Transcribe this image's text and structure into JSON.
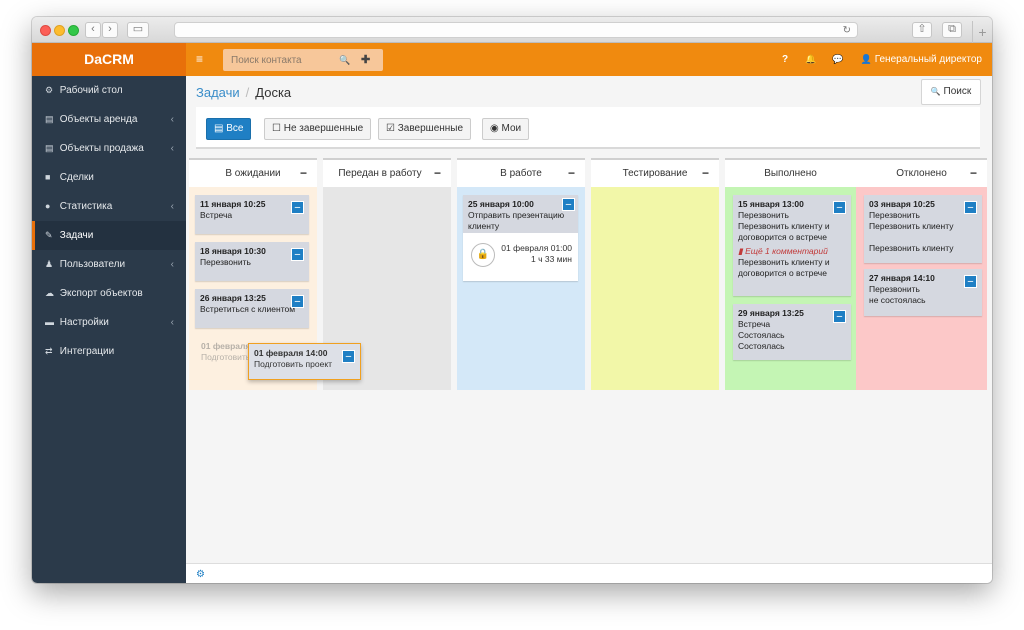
{
  "app": {
    "brand": "DaCRM"
  },
  "sidebar": {
    "items": [
      {
        "icon": "dashboard-icon",
        "glyph": "⚙",
        "label": "Рабочий стол",
        "chevron": ""
      },
      {
        "icon": "building-icon",
        "glyph": "▤",
        "label": "Объекты аренда",
        "chevron": "‹"
      },
      {
        "icon": "building-icon",
        "glyph": "▤",
        "label": "Объекты продажа",
        "chevron": "‹"
      },
      {
        "icon": "briefcase-icon",
        "glyph": "■",
        "label": "Сделки",
        "chevron": ""
      },
      {
        "icon": "info-icon",
        "glyph": "●",
        "label": "Статистика",
        "chevron": "‹"
      },
      {
        "icon": "edit-icon",
        "glyph": "✎",
        "label": "Задачи",
        "chevron": ""
      },
      {
        "icon": "user-icon",
        "glyph": "♟",
        "label": "Пользователи",
        "chevron": "‹"
      },
      {
        "icon": "cloud-icon",
        "glyph": "☁",
        "label": "Экспорт объектов",
        "chevron": ""
      },
      {
        "icon": "list-icon",
        "glyph": "▬",
        "label": "Настройки",
        "chevron": "‹"
      },
      {
        "icon": "exchange-icon",
        "glyph": "⇄",
        "label": "Интеграции",
        "chevron": ""
      }
    ]
  },
  "header": {
    "menu_glyph": "≡",
    "search_placeholder": "Поиск контакта",
    "search_glyph": "🔍",
    "add_glyph": "✚",
    "help_glyph": "?",
    "bell_glyph": "🔔",
    "chat_glyph": "💬",
    "user_glyph": "👤",
    "user_label": "Генеральный директор"
  },
  "breadcrumb": {
    "parent": "Задачи",
    "separator": "/",
    "current": "Доска"
  },
  "search_button": {
    "glyph": "🔍",
    "label": "Поиск"
  },
  "filters": [
    {
      "glyph": "▤",
      "label": "Все",
      "active": true
    },
    {
      "glyph": "☐",
      "label": "Не завершенные",
      "active": false
    },
    {
      "glyph": "☑",
      "label": "Завершенные",
      "active": false
    },
    {
      "glyph": "◉",
      "label": "Мои",
      "active": false
    }
  ],
  "columns": [
    {
      "title": "В ожидании",
      "color": "#fdf0e0",
      "minus": "−"
    },
    {
      "title": "Передан в работу",
      "color": "#e6e6e6",
      "minus": "−"
    },
    {
      "title": "В работе",
      "color": "#d4e8f8",
      "minus": "−"
    },
    {
      "title": "Тестирование",
      "color": "#f2f7a8",
      "minus": "−"
    },
    {
      "title": "Выполнено",
      "color": "#c4f5b4",
      "minus": ""
    },
    {
      "title": "Отклонено",
      "color": "#fcc8c8",
      "minus": "−"
    }
  ],
  "cards": {
    "waiting": [
      {
        "date": "11 января 10:25",
        "text": [
          "Встреча"
        ]
      },
      {
        "date": "18 января 10:30",
        "text": [
          "Перезвонить"
        ]
      },
      {
        "date": "26 января 13:25",
        "text": [
          "Встретиться с клиентом"
        ]
      }
    ],
    "ghost": {
      "date": "01 февраля",
      "text": "Подготовить"
    },
    "dragging": {
      "date": "01 февраля 14:00",
      "text": "Подготовить проект"
    },
    "in_progress": [
      {
        "date": "25 января 10:00",
        "text": [
          "Отправить презентацию",
          "клиенту"
        ]
      }
    ],
    "timer": {
      "date": "01 февраля 01:00",
      "duration": "1 ч 33 мин"
    },
    "done": [
      {
        "date": "15 января 13:00",
        "text": [
          "Перезвонить",
          "Перезвонить клиенту и",
          "договорится о встрече"
        ],
        "comment": "Ещё 1 комментарий",
        "after": [
          "Перезвонить клиенту и",
          "договорится о встрече"
        ]
      },
      {
        "date": "29 января 13:25",
        "text": [
          "Встреча",
          "Состоялась",
          "Состоялась"
        ]
      }
    ],
    "rejected": [
      {
        "date": "03 января 10:25",
        "text": [
          "Перезвонить",
          "Перезвонить клиенту",
          "",
          "Перезвонить клиенту"
        ]
      },
      {
        "date": "27 января 14:10",
        "text": [
          "Перезвонить",
          "не состоялась"
        ]
      }
    ]
  },
  "footer": {
    "gear_glyph": "⚙"
  }
}
